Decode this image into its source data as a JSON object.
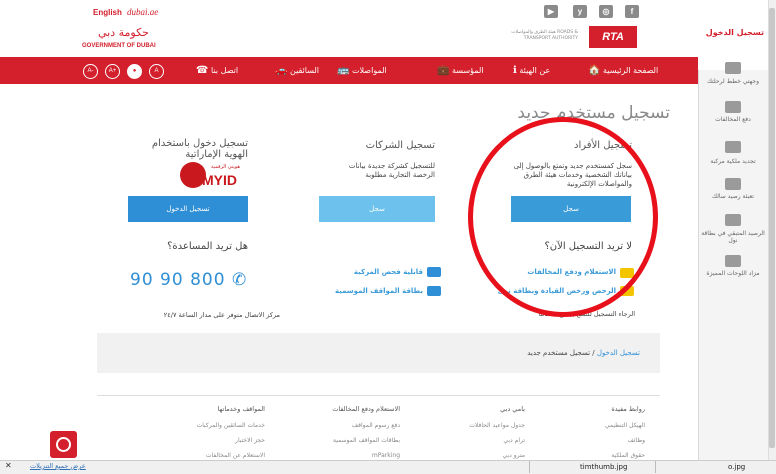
{
  "header": {
    "lang": "English",
    "dubai_link": "dubai.ae",
    "social": [
      "▶",
      "y",
      "◎",
      "f"
    ],
    "gov_logo": "GOVERNMENT OF DUBAI",
    "gov_logo_art": "حكومة دبي",
    "rta_logo": "RTA",
    "rta_text": "هيئة الطرق والمواصلات ROADS & TRANSPORT AUTHORITY"
  },
  "nav": {
    "items": [
      {
        "icon": "🏠",
        "label": "الصفحة الرئيسية"
      },
      {
        "icon": "ℹ",
        "label": "عن الهيئة"
      },
      {
        "icon": "💼",
        "label": "المؤسسة"
      },
      {
        "icon": "🚌",
        "label": "المواصلات"
      },
      {
        "icon": "🚗",
        "label": "السائقين"
      },
      {
        "icon": "☎",
        "label": "اتصل بنا"
      }
    ],
    "accessibility": [
      "A-",
      "A+",
      "●",
      "A"
    ]
  },
  "main": {
    "title": "تسجيل مستخدم جديد",
    "individuals": {
      "title": "تسجيل الأفراد",
      "desc": "سجل كمستخدم جديد وتمتع بالوصول إلى بياناتك الشخصية وخدمات هيئة الطرق والمواصلات الإلكترونية",
      "button": "سجل"
    },
    "corporate": {
      "title": "تسجيل الشركات",
      "desc": "للتسجيل كشركة جديدة بيانات الرخصة التجارية مطلوبة",
      "button": "سجل"
    },
    "uae_pass": {
      "title": "تسجيل دخول باستخدام الهوية الإماراتية",
      "logo": "MYID",
      "logo_small": "هويتي الرقمية",
      "button": "تسجيل الدخول"
    },
    "why_register": "لا تريد التسجيل الآن؟",
    "benefits": [
      "الاستعلام ودفع المخالفات",
      "الرخص ورخص القيادة وبطاقة نول",
      "قابلية فحص المركبة",
      "بطاقة المواقف الموسمية"
    ],
    "reg_note": "الرجاء التسجيل للتمتع بجميع خدماتنا",
    "help_title": "هل تريد المساعدة؟",
    "phone": "90 90 800",
    "phone_note": "مركز الاتصال متوفر على مدار الساعة ٢٤/٧"
  },
  "breadcrumb": {
    "link": "تسجيل الدخول",
    "current": " / تسجيل مستخدم جديد"
  },
  "footer": {
    "columns": [
      {
        "title": "روابط مفيدة",
        "items": [
          "الهيكل التنظيمي",
          "وظائف",
          "حقوق الملكية"
        ]
      },
      {
        "title": "بامي دبي",
        "items": [
          "جدول مواعيد الحافلات",
          "ترام دبي",
          "مترو دبي"
        ]
      },
      {
        "title": "الاستعلام ودفع المخالفات",
        "items": [
          "دفع رسوم المواقف",
          "بطاقات المواقف الموسمية",
          "mParking"
        ]
      },
      {
        "title": "المواقف وخدماتها",
        "items": [
          "خدمات السائقين والمركبات",
          "حجز الاختبار",
          "الاستعلام عن المخالفات"
        ]
      }
    ]
  },
  "right_panel": {
    "login": "تسجيل الدخول",
    "items": [
      "وجهتي خطط لرحلتك",
      "دفع المخالفات",
      "تجديد ملكية مركبة",
      "تعبئة رصيد سالك",
      "الرصيد المتبقي في بطاقة نول",
      "مزاد اللوحات المميزة"
    ]
  },
  "download_bar": {
    "close": "✕",
    "show_all": "عرض جميع التنزيلات",
    "files": [
      "timthumb.jpg",
      "o.jpg"
    ]
  }
}
